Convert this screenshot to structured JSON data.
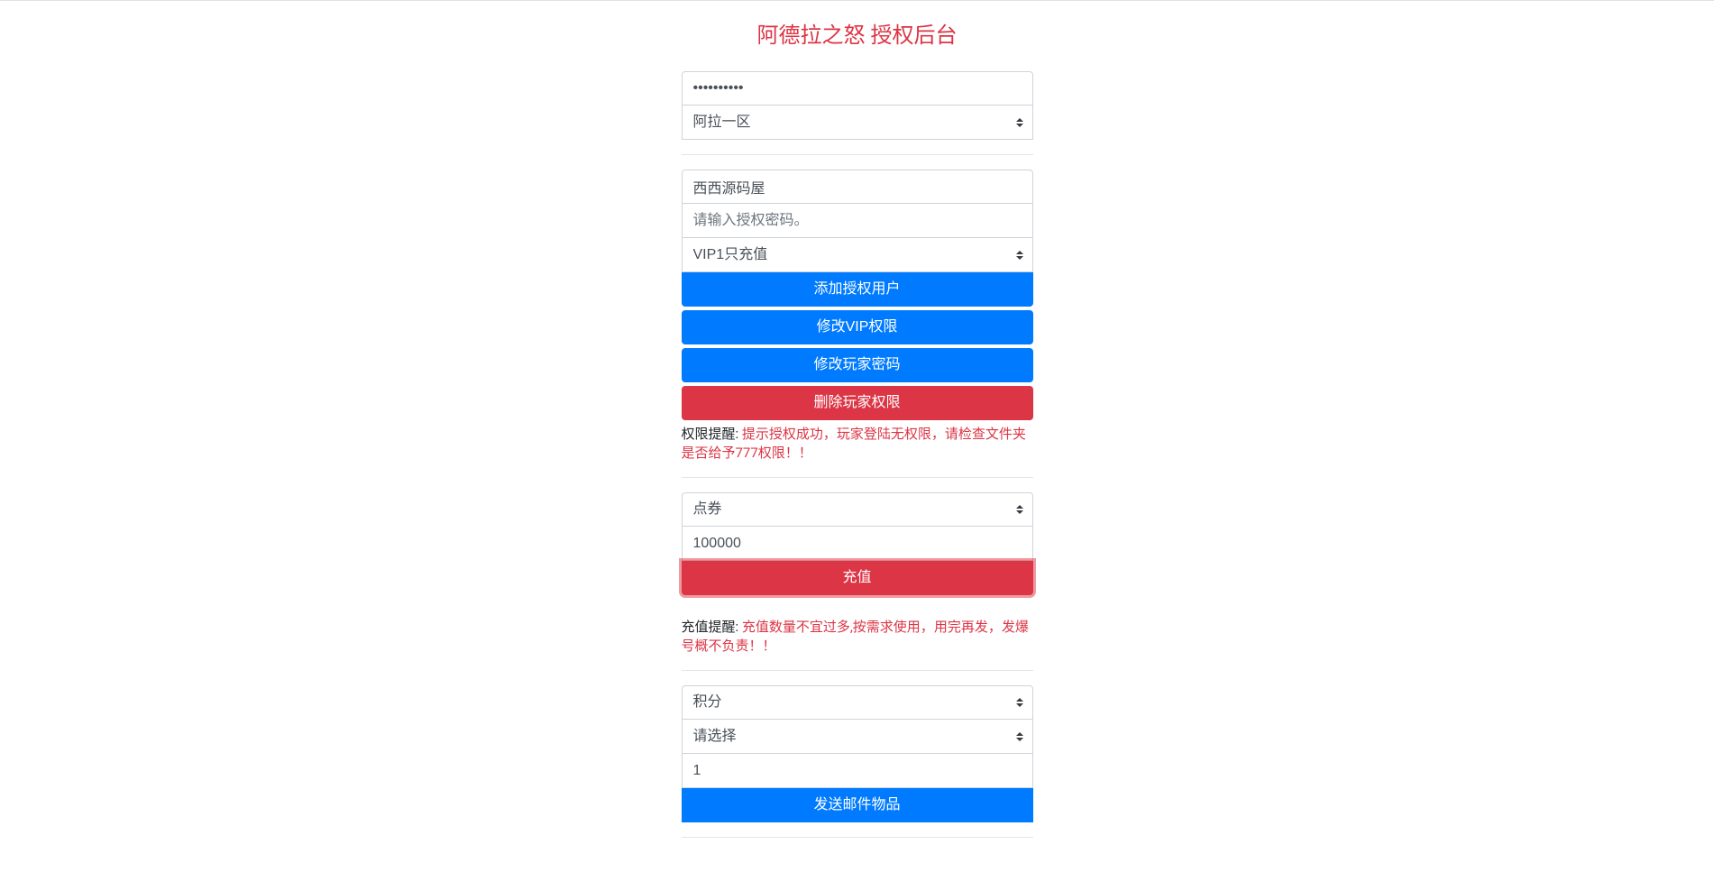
{
  "title": "阿德拉之怒 授权后台",
  "section1": {
    "password_value": "••••••••••",
    "region_select": "阿拉一区"
  },
  "section2": {
    "username_value": "西西源码屋",
    "auth_password_placeholder": "请输入授权密码。",
    "vip_select": "VIP1只充值",
    "buttons": {
      "add_user": "添加授权用户",
      "modify_vip": "修改VIP权限",
      "modify_password": "修改玩家密码",
      "delete_permission": "删除玩家权限"
    },
    "notice_label": "权限提醒: ",
    "notice_text": "提示授权成功，玩家登陆无权限，请检查文件夹是否给予777权限！！"
  },
  "section3": {
    "currency_select": "点券",
    "amount_value": "100000",
    "recharge_button": "充值",
    "notice_label": "充值提醒: ",
    "notice_text": "充值数量不宜过多,按需求使用，用完再发，发爆号概不负责！！"
  },
  "section4": {
    "item_select": "积分",
    "option_select": "请选择",
    "quantity_value": "1",
    "send_button": "发送邮件物品"
  }
}
